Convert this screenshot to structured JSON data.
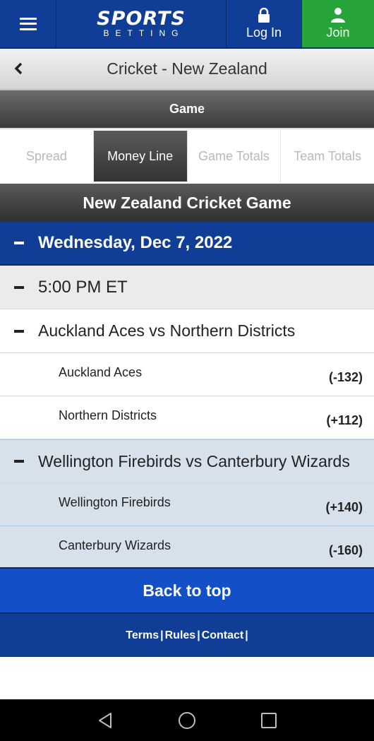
{
  "header": {
    "logo_main": "SPORTS",
    "logo_sub": "BETTING",
    "login_label": "Log In",
    "join_label": "Join"
  },
  "title": "Cricket - New Zealand",
  "game_label": "Game",
  "tabs": [
    {
      "label": "Spread",
      "active": false
    },
    {
      "label": "Money Line",
      "active": true
    },
    {
      "label": "Game Totals",
      "active": false
    },
    {
      "label": "Team Totals",
      "active": false
    }
  ],
  "section_title": "New Zealand Cricket Game",
  "date": "Wednesday, Dec 7, 2022",
  "time": "5:00 PM ET",
  "matches": [
    {
      "title": "Auckland Aces vs Northern Districts",
      "teams": [
        {
          "name": "Auckland Aces",
          "odds": "(-132)"
        },
        {
          "name": "Northern Districts",
          "odds": "(+112)"
        }
      ]
    },
    {
      "title": "Wellington Firebirds vs Canterbury Wizards",
      "teams": [
        {
          "name": "Wellington Firebirds",
          "odds": "(+140)"
        },
        {
          "name": "Canterbury Wizards",
          "odds": "(-160)"
        }
      ]
    }
  ],
  "back_to_top": "Back to top",
  "footer": {
    "terms": "Terms",
    "rules": "Rules",
    "contact": "Contact",
    "sep": "|"
  },
  "colors": {
    "brand_blue": "#103d96",
    "join_green": "#27a53b",
    "back_to_top_blue": "#1350c7",
    "selected_row": "#d6e1ec"
  }
}
